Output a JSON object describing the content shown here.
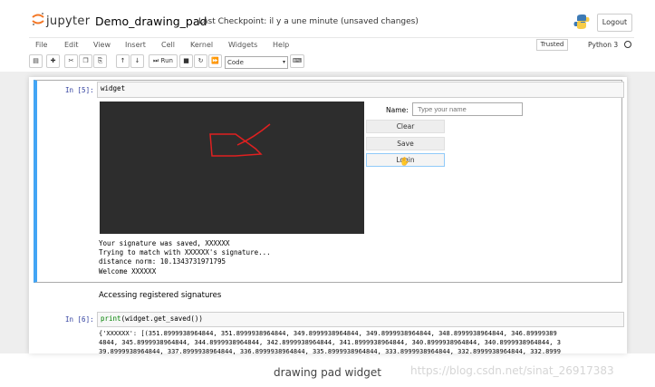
{
  "header": {
    "logo_text": "jupyter",
    "notebook_name": "Demo_drawing_pad",
    "checkpoint": "Last Checkpoint: il y a une minute  (unsaved changes)",
    "logout_label": "Logout"
  },
  "menubar": {
    "items": [
      "File",
      "Edit",
      "View",
      "Insert",
      "Cell",
      "Kernel",
      "Widgets",
      "Help"
    ],
    "trusted_label": "Trusted",
    "kernel_name": "Python 3"
  },
  "toolbar": {
    "run_label": "Run",
    "cell_type": "Code"
  },
  "cells": {
    "cell5": {
      "prompt": "In [5]:",
      "code": "widget",
      "widget": {
        "name_label": "Name:",
        "name_placeholder": "Type your name",
        "clear_label": "Clear",
        "save_label": "Save",
        "login_label": "Login"
      },
      "output": "Your signature was saved, XXXXXX\nTrying to match with XXXXXX's signature...\ndistance norm: 10.1343731971795\nWelcome XXXXXX"
    },
    "markdown": "Accessing registered signatures",
    "cell6": {
      "prompt": "In [6]:",
      "code_func": "print",
      "code_rest": "(widget.get_saved())",
      "output": "{'XXXXXX': [(351.8999938964844, 351.8999938964844, 349.8999938964844, 349.8999938964844, 348.8999938964844, 346.89999389\n4844, 345.8999938964844, 344.8999938964844, 342.8999938964844, 341.8999938964844, 340.8999938964844, 340.8999938964844, 3\n39.8999938964844, 337.8999938964844, 336.8999938964844, 335.8999938964844, 333.8999938964844, 332.8999938964844, 332.8999"
    }
  },
  "caption": "drawing pad widget",
  "watermark": "https://blog.csdn.net/sinat_26917383",
  "colors": {
    "cell_selected_border": "#42a5f5",
    "prompt": "#303f9f",
    "stroke": "#e02020",
    "canvas": "#2d2d2d"
  }
}
